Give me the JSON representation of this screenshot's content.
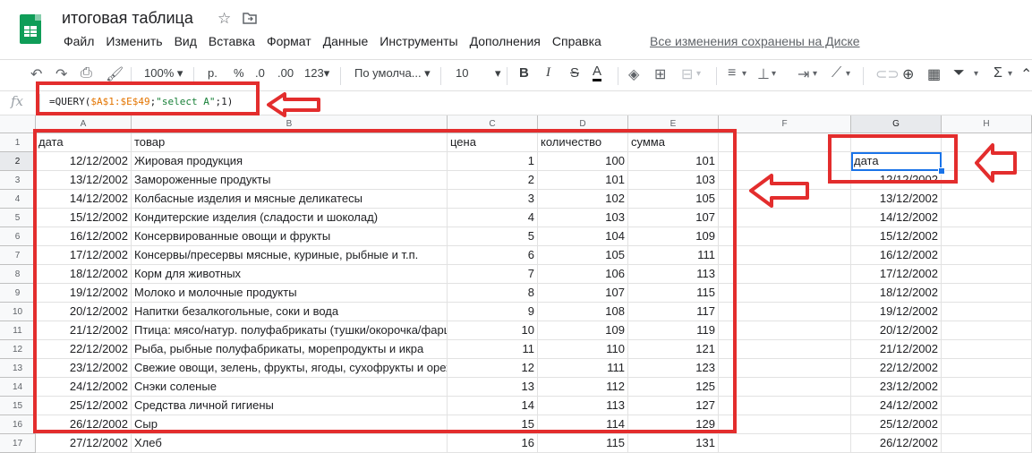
{
  "app": {
    "title": "итоговая таблица",
    "menu": [
      "Файл",
      "Изменить",
      "Вид",
      "Вставка",
      "Формат",
      "Данные",
      "Инструменты",
      "Дополнения",
      "Справка"
    ],
    "saved_status": "Все изменения сохранены на Диске"
  },
  "toolbar": {
    "zoom": "100%",
    "currency": "р.",
    "percent": "%",
    "decrease_decimals": ".0",
    "increase_decimals": ".00",
    "more_formats": "123",
    "font": "По умолча...",
    "font_size": "10",
    "bold": "B",
    "italic": "I",
    "strike": "S",
    "text_color": "A"
  },
  "formula_bar": {
    "fx": "fx",
    "formula_prefix": "=QUERY(",
    "formula_range": "$A$1:$E$49",
    "formula_sep": ";",
    "formula_query": "\"select A\"",
    "formula_suffix": ";1)"
  },
  "sheet": {
    "columns": [
      "A",
      "B",
      "C",
      "D",
      "E",
      "F",
      "G",
      "H"
    ],
    "selected_column": "G",
    "selected_row": "2",
    "row_numbers": [
      "1",
      "2",
      "3",
      "4",
      "5",
      "6",
      "7",
      "8",
      "9",
      "10",
      "11",
      "12",
      "13",
      "14",
      "15",
      "16",
      "17"
    ],
    "headers": {
      "a": "дата",
      "b": "товар",
      "c": "цена",
      "d": "количество",
      "e": "сумма"
    },
    "rows": [
      {
        "a": "12/12/2002",
        "b": "Жировая продукция",
        "c": "1",
        "d": "100",
        "e": "101",
        "g": "дата"
      },
      {
        "a": "13/12/2002",
        "b": "Замороженные продукты",
        "c": "2",
        "d": "101",
        "e": "103",
        "g": "12/12/2002"
      },
      {
        "a": "14/12/2002",
        "b": "Колбасные изделия и мясные деликатесы",
        "c": "3",
        "d": "102",
        "e": "105",
        "g": "13/12/2002"
      },
      {
        "a": "15/12/2002",
        "b": "Кондитерские изделия (сладости и шоколад)",
        "c": "4",
        "d": "103",
        "e": "107",
        "g": "14/12/2002"
      },
      {
        "a": "16/12/2002",
        "b": "Консервированные овощи и фрукты",
        "c": "5",
        "d": "104",
        "e": "109",
        "g": "15/12/2002"
      },
      {
        "a": "17/12/2002",
        "b": "Консервы/пресервы мясные, куриные, рыбные и т.п.",
        "c": "6",
        "d": "105",
        "e": "111",
        "g": "16/12/2002"
      },
      {
        "a": "18/12/2002",
        "b": "Корм для животных",
        "c": "7",
        "d": "106",
        "e": "113",
        "g": "17/12/2002"
      },
      {
        "a": "19/12/2002",
        "b": "Молоко и молочные продукты",
        "c": "8",
        "d": "107",
        "e": "115",
        "g": "18/12/2002"
      },
      {
        "a": "20/12/2002",
        "b": "Напитки безалкогольные, соки и вода",
        "c": "9",
        "d": "108",
        "e": "117",
        "g": "19/12/2002"
      },
      {
        "a": "21/12/2002",
        "b": "Птица: мясо/натур. полуфабрикаты (тушки/окорочка/фарш",
        "c": "10",
        "d": "109",
        "e": "119",
        "g": "20/12/2002"
      },
      {
        "a": "22/12/2002",
        "b": "Рыба, рыбные полуфабрикаты, морепродукты и икра",
        "c": "11",
        "d": "110",
        "e": "121",
        "g": "21/12/2002"
      },
      {
        "a": "23/12/2002",
        "b": "Свежие овощи, зелень, фрукты, ягоды, сухофрукты и орех",
        "c": "12",
        "d": "111",
        "e": "123",
        "g": "22/12/2002"
      },
      {
        "a": "24/12/2002",
        "b": "Снэки соленые",
        "c": "13",
        "d": "112",
        "e": "125",
        "g": "23/12/2002"
      },
      {
        "a": "25/12/2002",
        "b": "Средства личной гигиены",
        "c": "14",
        "d": "113",
        "e": "127",
        "g": "24/12/2002"
      },
      {
        "a": "26/12/2002",
        "b": "Сыр",
        "c": "15",
        "d": "114",
        "e": "129",
        "g": "25/12/2002"
      },
      {
        "a": "27/12/2002",
        "b": "Хлеб",
        "c": "16",
        "d": "115",
        "e": "131",
        "g": "26/12/2002"
      }
    ]
  },
  "colors": {
    "annotation": "#e32d2d",
    "selection": "#1a73e8",
    "brand": "#0f9d58"
  }
}
